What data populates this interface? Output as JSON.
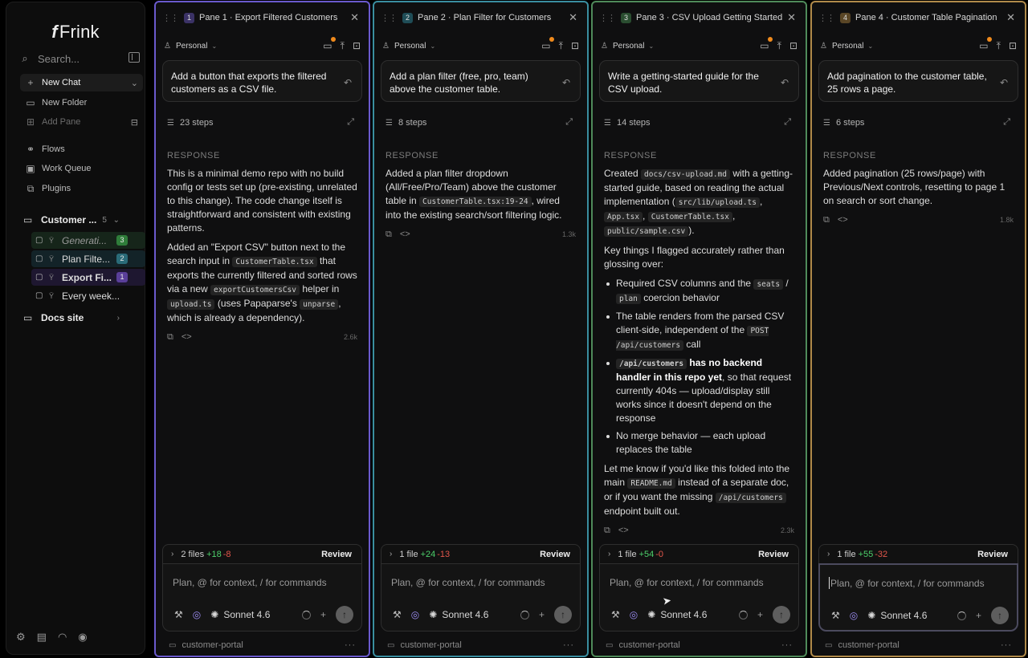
{
  "app": {
    "name": "Frink"
  },
  "sidebar": {
    "search_placeholder": "Search...",
    "new_chat": "New Chat",
    "items": [
      {
        "label": "New Folder",
        "icon": "folder-plus-icon"
      },
      {
        "label": "Add Pane",
        "icon": "add-pane-icon"
      },
      {
        "label": "Flows",
        "icon": "flows-icon"
      },
      {
        "label": "Work Queue",
        "icon": "queue-icon"
      },
      {
        "label": "Plugins",
        "icon": "plugin-icon"
      }
    ],
    "folders": [
      {
        "name": "Customer ...",
        "count": "5"
      },
      {
        "name": "Docs site"
      }
    ],
    "chats": [
      {
        "label": "Generati...",
        "badge": "3",
        "badge_color": "#2f7d3a",
        "bg": "#16251a"
      },
      {
        "label": "Plan Filte...",
        "badge": "2",
        "badge_color": "#2a6b78",
        "bg": "#132328"
      },
      {
        "label": "Export Fi...",
        "badge": "1",
        "badge_color": "#5a3f9a",
        "bg": "#1e1730"
      },
      {
        "label": "Every week..."
      }
    ]
  },
  "panes": [
    {
      "num": "1",
      "title": "Pane 1 · Export Filtered Customers",
      "color": "#6a5acd",
      "num_bg": "#3b3266",
      "workspace": "Personal",
      "prompt": "Add a button that exports the filtered customers as a CSV file.",
      "steps": "23 steps",
      "response_label": "RESPONSE",
      "size": "2.6k",
      "files": "2 files",
      "added": "+18",
      "removed": "-8",
      "review": "Review",
      "placeholder": "Plan, @ for context, / for commands",
      "model": "Sonnet 4.6",
      "folder": "customer-portal"
    },
    {
      "num": "2",
      "title": "Pane 2 · Plan Filter for Customers",
      "color": "#3a8ea0",
      "num_bg": "#1f4d57",
      "workspace": "Personal",
      "prompt": "Add a plan filter (free, pro, team) above the customer table.",
      "steps": "8 steps",
      "response_label": "RESPONSE",
      "size": "1.3k",
      "files": "1 file",
      "added": "+24",
      "removed": "-13",
      "review": "Review",
      "placeholder": "Plan, @ for context, / for commands",
      "model": "Sonnet 4.6",
      "folder": "customer-portal"
    },
    {
      "num": "3",
      "title": "Pane 3 · CSV Upload Getting Started",
      "color": "#4f8a5a",
      "num_bg": "#2a4d30",
      "workspace": "Personal",
      "prompt": "Write a getting-started guide for the CSV upload.",
      "steps": "14 steps",
      "response_label": "RESPONSE",
      "size": "2.3k",
      "files": "1 file",
      "added": "+54",
      "removed": "-0",
      "review": "Review",
      "placeholder": "Plan, @ for context, / for commands",
      "model": "Sonnet 4.6",
      "folder": "customer-portal"
    },
    {
      "num": "4",
      "title": "Pane 4 · Customer Table Pagination",
      "color": "#b08a4a",
      "num_bg": "#5a4626",
      "workspace": "Personal",
      "prompt": "Add pagination to the customer table, 25 rows a page.",
      "steps": "6 steps",
      "response_label": "RESPONSE",
      "size": "1.8k",
      "files": "1 file",
      "added": "+55",
      "removed": "-32",
      "review": "Review",
      "placeholder": "Plan, @ for context, / for commands",
      "model": "Sonnet 4.6",
      "folder": "customer-portal"
    }
  ],
  "responses": {
    "p1": {
      "a": "This is a minimal demo repo with no build config or tests set up (pre-existing, unrelated to this change). The code change itself is straightforward and consistent with existing patterns.",
      "b1": "Added an \"Export CSV\" button next to the search input in ",
      "c1": "CustomerTable.tsx",
      "b2": " that exports the currently filtered and sorted rows via a new ",
      "c2": "exportCustomersCsv",
      "b3": " helper in ",
      "c3": "upload.ts",
      "b4": " (uses Papaparse's ",
      "c4": "unparse",
      "b5": ", which is already a dependency)."
    },
    "p2": {
      "a1": "Added a plan filter dropdown (All/Free/Pro/Team) above the customer table in ",
      "c1": "CustomerTable.tsx:19-24",
      "a2": ", wired into the existing search/sort filtering logic."
    },
    "p3": {
      "a1": "Created ",
      "c1": "docs/csv-upload.md",
      "a2": " with a getting-started guide, based on reading the actual implementation (",
      "c2": "src/lib/upload.ts",
      "a3": ", ",
      "c3": "App.tsx",
      "a4": ", ",
      "c4": "CustomerTable.tsx",
      "a5": ", ",
      "c5": "public/sample.csv",
      "a6": ").",
      "b": "Key things I flagged accurately rather than glossing over:",
      "l1a": "Required CSV columns and the ",
      "l1c1": "seats",
      "l1b": " / ",
      "l1c2": "plan",
      "l1d": " coercion behavior",
      "l2a": "The table renders from the parsed CSV client-side, independent of the ",
      "l2c": "POST /api/customers",
      "l2b": " call",
      "l3c": "/api/customers",
      "l3b": " has no backend handler in this repo yet",
      "l3d": ", so that request currently 404s — upload/display still works since it doesn't depend on the response",
      "l4": "No merge behavior — each upload replaces the table",
      "e1": "Let me know if you'd like this folded into the main ",
      "ec1": "README.md",
      "e2": " instead of a separate doc, or if you want the missing ",
      "ec2": "/api/customers",
      "e3": " endpoint built out."
    },
    "p4": {
      "a": "Added pagination (25 rows/page) with Previous/Next controls, resetting to page 1 on search or sort change."
    }
  }
}
